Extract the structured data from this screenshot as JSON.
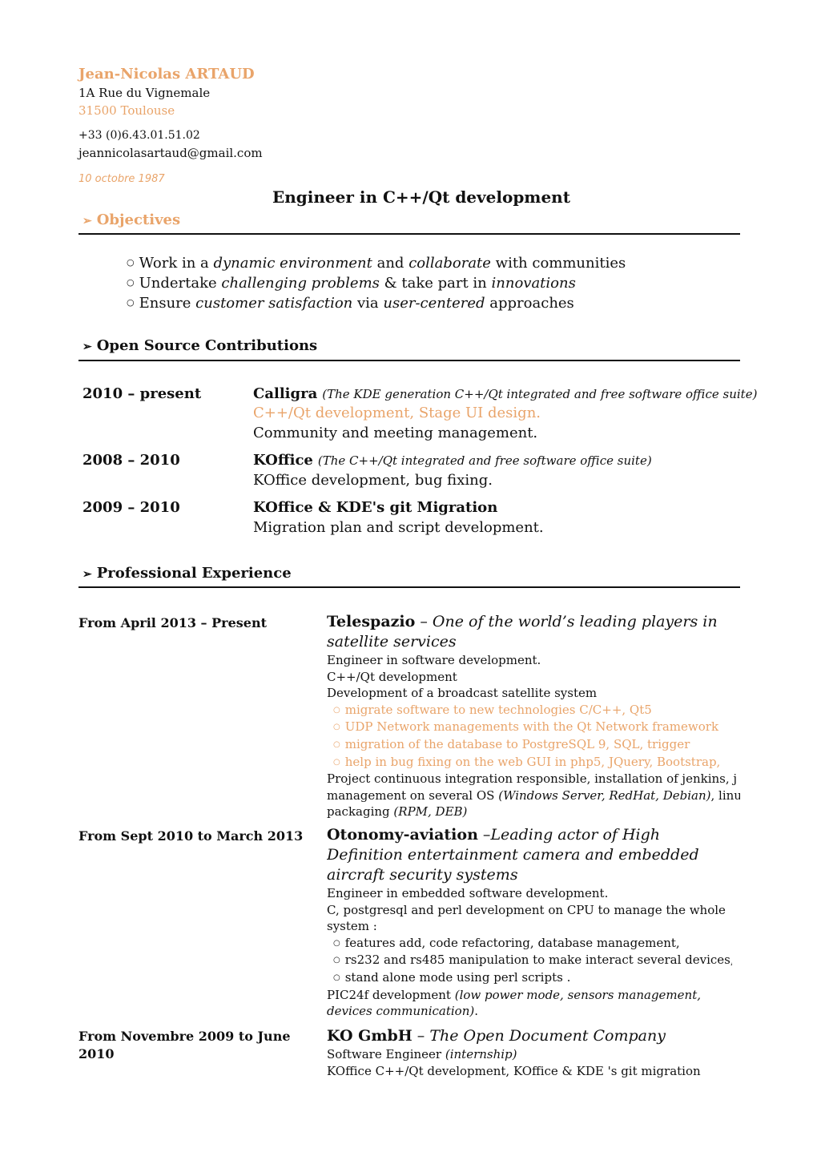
{
  "header": {
    "name": "Jean-Nicolas ARTAUD",
    "address_line1": "1A Rue du Vignemale",
    "address_line2": "31500 Toulouse",
    "phone": "+33 (0)6.43.01.51.02",
    "email": "jeannicolasartaud@gmail.com",
    "birth_date": "10 octobre 1987",
    "job_title": "Engineer in C++/Qt development",
    "accent_color": "#e9a46a"
  },
  "objectives": {
    "heading": "Objectives",
    "items": [
      {
        "a": "Work in a ",
        "b": "dynamic environment",
        "c": " and ",
        "d": "collaborate",
        "e": " with communities"
      },
      {
        "a": "Undertake ",
        "b": "challenging problems",
        "c": " & take part in ",
        "d": "innovations",
        "e": ""
      },
      {
        "a": "Ensure ",
        "b": "customer satisfaction",
        "c": " via ",
        "d": "user-centered",
        "e": " approaches"
      }
    ]
  },
  "open_source": {
    "heading": "Open Source Contributions",
    "entries": [
      {
        "dates": "2010 – present",
        "project": "Calligra",
        "description": "(The KDE generation C++/Qt integrated and free software office suite)",
        "lines": [
          "C++/Qt development, Stage UI design.",
          "Community and meeting management."
        ]
      },
      {
        "dates": "2008 – 2010",
        "project": "KOffice",
        "description": "(The C++/Qt integrated and free software office suite)",
        "lines": [
          "KOffice development, bug fixing."
        ]
      },
      {
        "dates": "2009 – 2010",
        "project": "KOffice & KDE's git Migration",
        "description": "",
        "lines": [
          "Migration plan and script development."
        ]
      }
    ]
  },
  "experience": {
    "heading": "Professional Experience",
    "jobs": [
      {
        "dates": "From April  2013 – Present",
        "company": "Telespazio",
        "separator": " – ",
        "tagline": "One of the world’s leading players in satellite services",
        "lines": [
          "Engineer in software development.",
          "C++/Qt development",
          "Development of a broadcast satellite system"
        ],
        "bullets": [
          "migrate software to new technologies C/C++, Qt5",
          "UDP Network managements with the Qt Network framework",
          "migration of the database to PostgreSQL 9, SQL, trigger",
          "help in bug fixing on the web GUI in php5, JQuery, Bootstrap,"
        ],
        "after_lines": [
          {
            "text": "Project continuous integration responsible, installation of jenkins, j",
            "italic": ""
          },
          {
            "text": "management on several OS ",
            "italic": "(Windows Server, RedHat, Debian)",
            "rest": ", linu"
          },
          {
            "text": "packaging ",
            "italic": "(RPM, DEB)"
          }
        ]
      },
      {
        "dates": "From Sept 2010 to March  2013",
        "company": "Otonomy-aviation",
        "separator": " –",
        "tagline": "Leading actor of High Definition entertainment camera and  embedded aircraft security systems",
        "lines": [
          "Engineer in embedded software development.",
          "C, postgresql and perl development on CPU to manage the whole system :"
        ],
        "bullets": [
          "features add, code refactoring, database management,",
          "rs232 and rs485 manipulation to make interact several devices,",
          "stand alone mode using perl scripts ."
        ],
        "after_lines": [
          {
            "text": "PIC24f development ",
            "italic": "(low power mode, sensors management, devices communication)",
            "rest": "."
          }
        ]
      },
      {
        "dates": "From Novembre 2009 to June 2010",
        "company": "KO GmbH",
        "separator": " – ",
        "tagline": "The Open Document Company",
        "role": "Software Engineer ",
        "role_note": "(internship)",
        "lines": [
          "KOffice C++/Qt development, KOffice & KDE 's git migration"
        ]
      }
    ]
  }
}
